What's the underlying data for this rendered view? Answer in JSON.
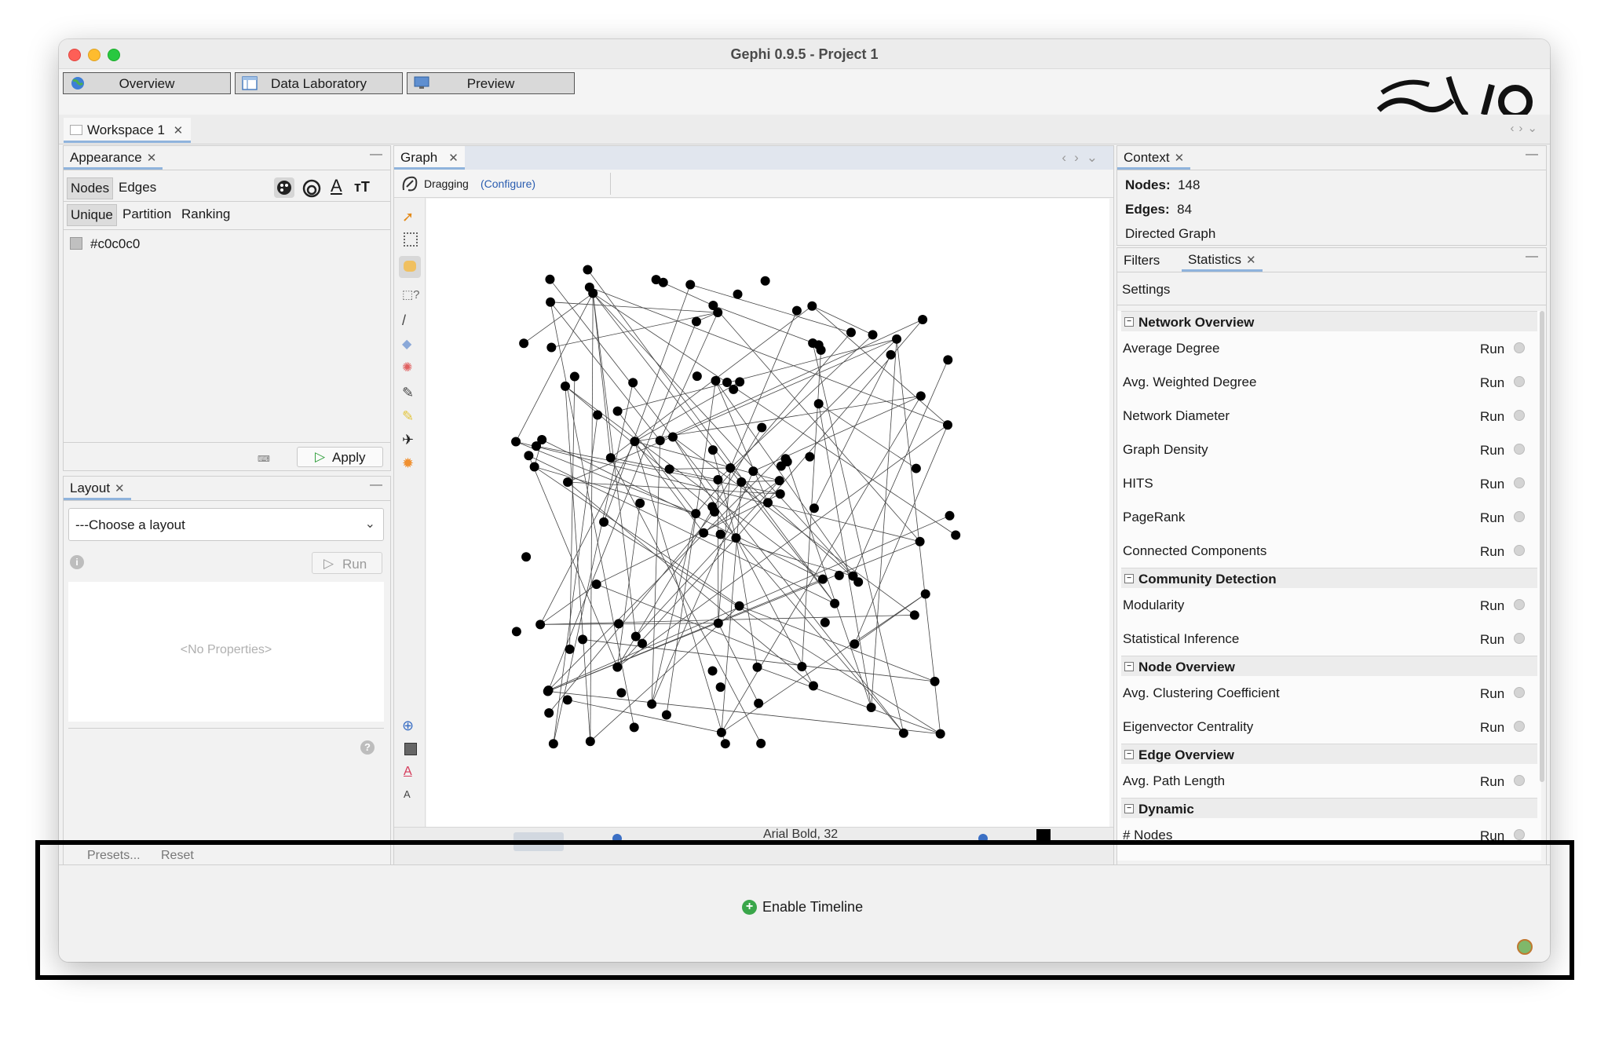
{
  "window": {
    "title": "Gephi 0.9.5 - Project 1"
  },
  "modes": [
    {
      "label": "Overview",
      "icon": "globe-icon"
    },
    {
      "label": "Data Laboratory",
      "icon": "table-icon"
    },
    {
      "label": "Preview",
      "icon": "monitor-icon"
    }
  ],
  "workspace": {
    "tab_label": "Workspace 1",
    "close": "✕"
  },
  "appearance": {
    "title": "Appearance",
    "element_tabs": [
      "Nodes",
      "Edges"
    ],
    "mode_tabs": [
      "Unique",
      "Partition",
      "Ranking"
    ],
    "color_value": "#c0c0c0",
    "apply_label": "Apply"
  },
  "layout": {
    "title": "Layout",
    "select_value": "---Choose a layout",
    "run_label": "Run",
    "no_properties": "<No Properties>",
    "presets_label": "Presets...",
    "reset_label": "Reset"
  },
  "graph": {
    "tab_label": "Graph",
    "tool_label": "Dragging",
    "configure_label": "(Configure)",
    "font_label": "Arial Bold, 32"
  },
  "context": {
    "title": "Context",
    "nodes_label": "Nodes:",
    "nodes_value": "148",
    "edges_label": "Edges:",
    "edges_value": "84",
    "graph_type": "Directed Graph"
  },
  "statistics": {
    "filters_tab": "Filters",
    "statistics_tab": "Statistics",
    "settings_label": "Settings",
    "run_label": "Run",
    "categories": [
      {
        "name": "Network Overview",
        "items": [
          "Average Degree",
          "Avg. Weighted Degree",
          "Network Diameter",
          "Graph Density",
          "HITS",
          "PageRank",
          "Connected Components"
        ]
      },
      {
        "name": "Community Detection",
        "items": [
          "Modularity",
          "Statistical Inference"
        ]
      },
      {
        "name": "Node Overview",
        "items": [
          "Avg. Clustering Coefficient",
          "Eigenvector Centrality"
        ]
      },
      {
        "name": "Edge Overview",
        "items": [
          "Avg. Path Length"
        ]
      },
      {
        "name": "Dynamic",
        "items": [
          "# Nodes"
        ]
      }
    ]
  },
  "timeline": {
    "enable_label": "Enable Timeline"
  },
  "colors": {
    "accent": "#8fb3dc",
    "link": "#2a5db0",
    "node": "#000000",
    "edge": "#444444"
  }
}
